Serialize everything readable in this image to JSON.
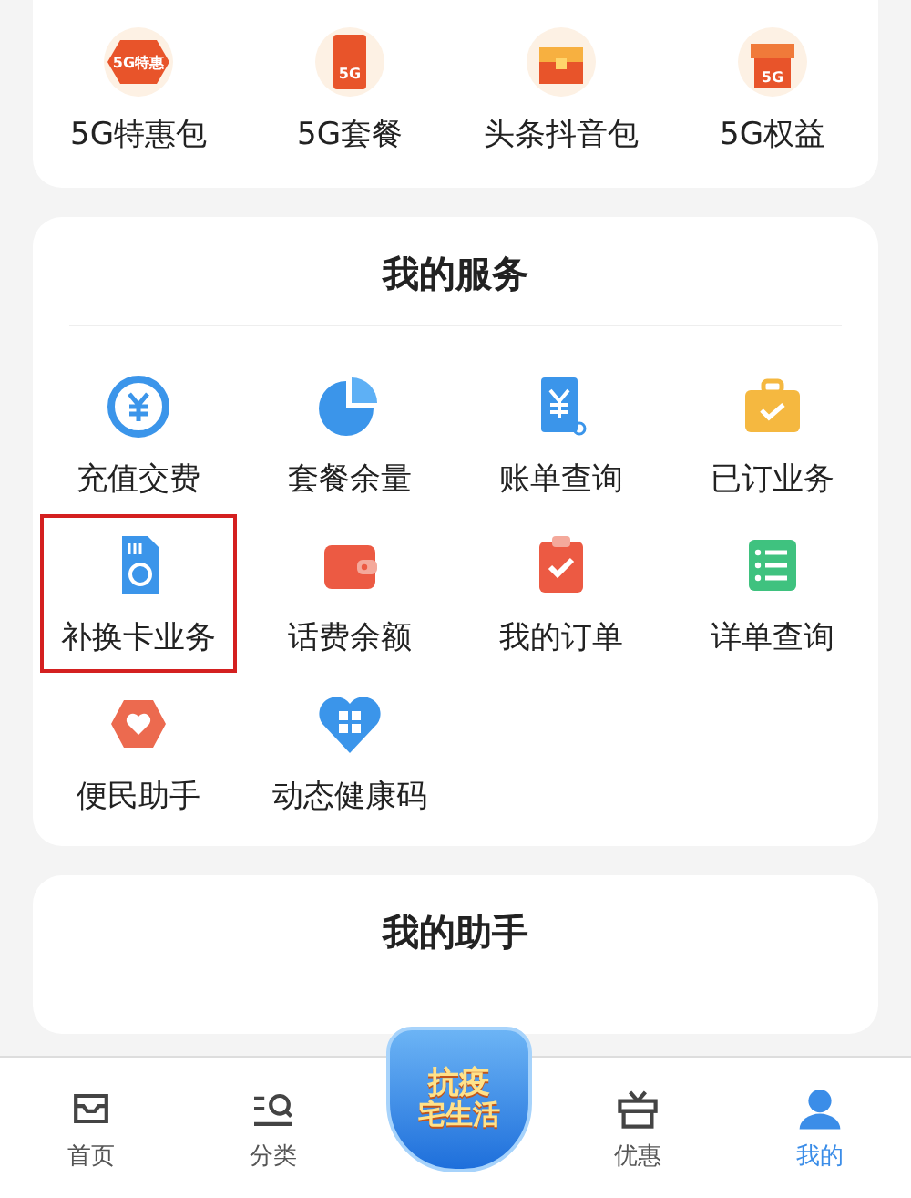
{
  "promo_items": [
    {
      "label": "5G特惠包",
      "icon_text": "5G特惠"
    },
    {
      "label": "5G套餐",
      "icon_text": "5G"
    },
    {
      "label": "头条抖音包"
    },
    {
      "label": "5G权益",
      "icon_text": "5G"
    }
  ],
  "services": {
    "title": "我的服务",
    "items": [
      {
        "label": "充值交费",
        "highlighted": false
      },
      {
        "label": "套餐余量",
        "highlighted": false
      },
      {
        "label": "账单查询",
        "highlighted": false
      },
      {
        "label": "已订业务",
        "highlighted": false
      },
      {
        "label": "补换卡业务",
        "highlighted": true
      },
      {
        "label": "话费余额",
        "highlighted": false
      },
      {
        "label": "我的订单",
        "highlighted": false
      },
      {
        "label": "详单查询",
        "highlighted": false
      },
      {
        "label": "便民助手",
        "highlighted": false
      },
      {
        "label": "动态健康码",
        "highlighted": false
      }
    ]
  },
  "assistant": {
    "title": "我的助手"
  },
  "tab_bar": {
    "items": [
      {
        "label": "首页",
        "selected": false
      },
      {
        "label": "分类",
        "selected": false
      },
      {
        "label": "优惠",
        "selected": false
      },
      {
        "label": "我的",
        "selected": true
      }
    ],
    "center_badge": {
      "line_1": "抗疫",
      "line_2": "宅生活"
    }
  }
}
